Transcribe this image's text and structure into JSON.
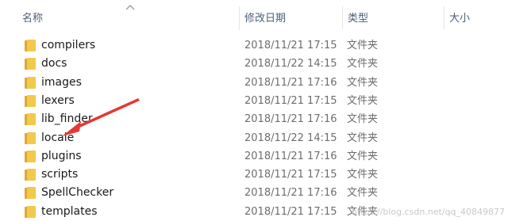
{
  "header": {
    "name_label": "名称",
    "date_label": "修改日期",
    "type_label": "类型",
    "size_label": "大小"
  },
  "rows": [
    {
      "name": "compilers",
      "date": "2018/11/21 17:15",
      "type": "文件夹",
      "icon": "folder-icon"
    },
    {
      "name": "docs",
      "date": "2018/11/22 14:15",
      "type": "文件夹",
      "icon": "folder-icon"
    },
    {
      "name": "images",
      "date": "2018/11/21 17:16",
      "type": "文件夹",
      "icon": "folder-icon"
    },
    {
      "name": "lexers",
      "date": "2018/11/21 17:15",
      "type": "文件夹",
      "icon": "folder-icon"
    },
    {
      "name": "lib_finder",
      "date": "2018/11/21 17:16",
      "type": "文件夹",
      "icon": "folder-icon"
    },
    {
      "name": "locale",
      "date": "2018/11/22 14:15",
      "type": "文件夹",
      "icon": "folder-icon"
    },
    {
      "name": "plugins",
      "date": "2018/11/21 17:16",
      "type": "文件夹",
      "icon": "folder-icon"
    },
    {
      "name": "scripts",
      "date": "2018/11/21 17:15",
      "type": "文件夹",
      "icon": "folder-icon"
    },
    {
      "name": "SpellChecker",
      "date": "2018/11/21 17:16",
      "type": "文件夹",
      "icon": "folder-icon"
    },
    {
      "name": "templates",
      "date": "2018/11/21 17:15",
      "type": "文件夹",
      "icon": "folder-icon"
    }
  ],
  "watermark": "https://blog.csdn.net/qq_40849877",
  "colors": {
    "folder": "#f2c94c",
    "folder_dark": "#dca836",
    "arrow": "#e53935",
    "header_text": "#4c607a"
  }
}
